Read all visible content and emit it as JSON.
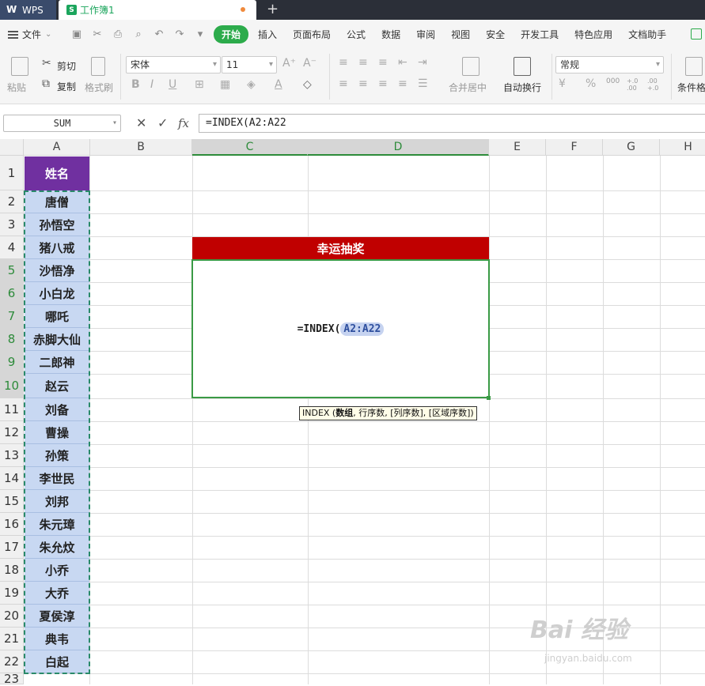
{
  "titlebar": {
    "app_label": "WPS",
    "doc_name": "工作簿1",
    "new_tab": "+"
  },
  "menubar": {
    "file_label": "文件",
    "items": [
      "开始",
      "插入",
      "页面布局",
      "公式",
      "数据",
      "审阅",
      "视图",
      "安全",
      "开发工具",
      "特色应用",
      "文档助手"
    ]
  },
  "ribbon": {
    "paste": "粘贴",
    "cut": "剪切",
    "copy": "复制",
    "format_painter": "格式刷",
    "font_name": "宋体",
    "font_size": "11",
    "merge_center": "合并居中",
    "wrap_text": "自动换行",
    "number_format": "常规",
    "conditional_format": "条件格式",
    "percent": "%",
    "thousands": "000",
    "inc_decimal": "+.0 .00",
    "dec_decimal": ".00 +.0"
  },
  "formula_bar": {
    "name_box": "SUM",
    "formula": "=INDEX(A2:A22",
    "fx_label": "fx"
  },
  "grid": {
    "columns": [
      "A",
      "B",
      "C",
      "D",
      "E",
      "F",
      "G",
      "H"
    ],
    "rows": [
      "1",
      "2",
      "3",
      "4",
      "5",
      "6",
      "7",
      "8",
      "9",
      "10",
      "11",
      "12",
      "13",
      "14",
      "15",
      "16",
      "17",
      "18",
      "19",
      "20",
      "21",
      "22",
      "23"
    ],
    "header_cell": "姓名",
    "names": [
      "唐僧",
      "孙悟空",
      "猪八戒",
      "沙悟净",
      "小白龙",
      "哪吒",
      "赤脚大仙",
      "二郎神",
      "赵云",
      "刘备",
      "曹操",
      "孙策",
      "李世民",
      "刘邦",
      "朱元璋",
      "朱允炆",
      "小乔",
      "大乔",
      "夏侯淳",
      "典韦",
      "白起"
    ],
    "banner": "幸运抽奖",
    "edit_prefix": "=INDEX(",
    "edit_ref": "A2:A22",
    "tooltip_prefix": "INDEX (",
    "tooltip_bold": "数组",
    "tooltip_rest": ", 行序数, [列序数], [区域序数])"
  },
  "watermark": {
    "text": "Bai 经验",
    "sub": "jingyan.baidu.com"
  },
  "colors": {
    "accent_green": "#2cab4b",
    "header_purple": "#7030a0",
    "banner_red": "#c00000",
    "name_fill": "#c8d8f2"
  }
}
